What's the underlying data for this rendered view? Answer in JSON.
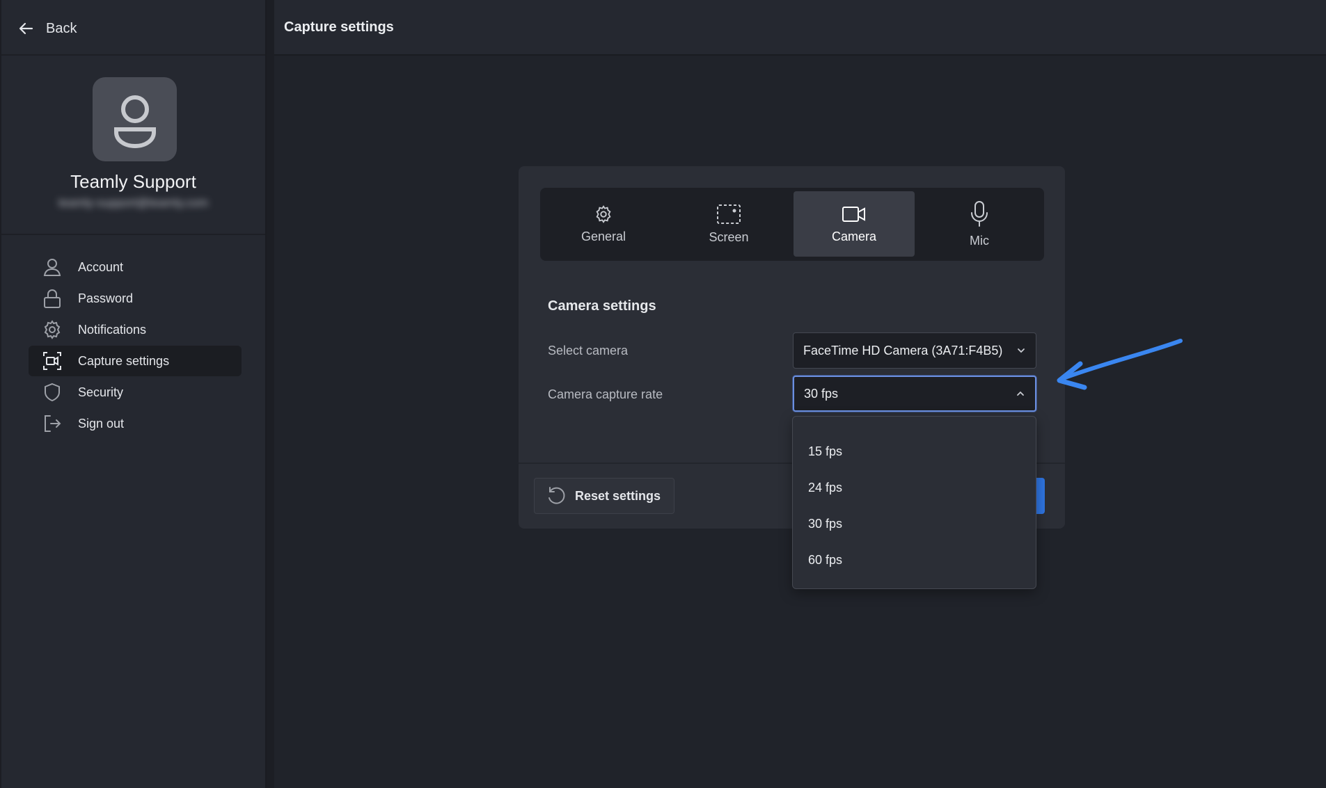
{
  "sidebar": {
    "back_label": "Back",
    "user": {
      "name": "Teamly Support",
      "email": "teamly-support@teamly.com"
    },
    "items": [
      {
        "label": "Account",
        "icon": "user-icon"
      },
      {
        "label": "Password",
        "icon": "lock-icon"
      },
      {
        "label": "Notifications",
        "icon": "gear-icon"
      },
      {
        "label": "Capture settings",
        "icon": "capture-icon",
        "active": true
      },
      {
        "label": "Security",
        "icon": "shield-icon"
      },
      {
        "label": "Sign out",
        "icon": "sign-out-icon"
      }
    ]
  },
  "header": {
    "title": "Capture settings"
  },
  "tabs": [
    {
      "label": "General",
      "icon": "gear-icon"
    },
    {
      "label": "Screen",
      "icon": "screen-capture-icon"
    },
    {
      "label": "Camera",
      "icon": "video-camera-icon",
      "active": true
    },
    {
      "label": "Mic",
      "icon": "microphone-icon"
    }
  ],
  "camera_settings": {
    "title": "Camera settings",
    "select_camera_label": "Select camera",
    "select_camera_value": "FaceTime HD Camera (3A71:F4B5)",
    "capture_rate_label": "Camera capture rate",
    "capture_rate_value": "30 fps",
    "capture_rate_options": [
      "15 fps",
      "24 fps",
      "30 fps",
      "60 fps"
    ]
  },
  "footer": {
    "reset_label": "Reset settings"
  },
  "colors": {
    "accent": "#2f74e0",
    "annotation_arrow": "#3a86f0",
    "background": "#1c1e24",
    "panel": "#2b2e36"
  }
}
